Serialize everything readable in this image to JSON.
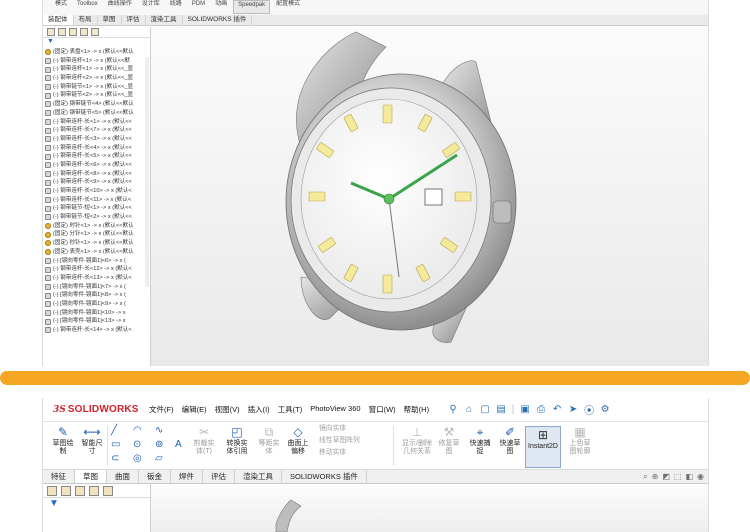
{
  "top": {
    "ribbon": [
      "模式",
      "Toolbox",
      "曲线操作",
      "设计库",
      "线路",
      "PDM",
      "动画",
      "Speedpak",
      "配置模式"
    ],
    "tabs": [
      "装配体",
      "布局",
      "草图",
      "评估",
      "渲染工具",
      "SOLIDWORKS 插件"
    ],
    "tree": [
      "(固定) 表盘<1> -> x (默认<<默认",
      "(-) 钢带连杆<1> -> x (默认<<默",
      "(-) 钢带连杆<1> -> x (默认<<_显",
      "(-) 钢带连杆<2> -> x (默认<<_显",
      "(-) 钢带链节<1> -> x (默认<<_显",
      "(-) 钢带链节<2> -> x (默认<<_显",
      "(固定) 钢带链节<4> (默认<<默认",
      "(固定) 钢带链节<5> (默认<<默认",
      "(-) 钢带连杆-长<1> -> x (默认<<",
      "(-) 钢带连杆-长<7> -> x (默认<<",
      "(-) 钢带连杆-长<3> -> x (默认<<",
      "(-) 钢带连杆-长<4> -> x (默认<<",
      "(-) 钢带连杆-长<5> -> x (默认<<",
      "(-) 钢带连杆-长<6> -> x (默认<<",
      "(-) 钢带连杆-长<8> -> x (默认<<",
      "(-) 钢带连杆-长<9> -> x (默认<<",
      "(-) 钢带连杆-长<10> -> x (默认<",
      "(-) 钢带连杆-长<11> -> x (默认<",
      "(-) 钢带链节-短<1> -> x (默认<<",
      "(-) 钢带链节-短<2> -> x (默认<<",
      "(固定) 时针<1> -> x (默认<<默认",
      "(固定) 分针<1> -> x (默认<<默认",
      "(固定) 秒针<1> -> x (默认<<默认",
      "(固定) 表壳<1> -> x (默认<<默认",
      "(-) [镜向零件-镜面1]<6> -> x (",
      "(-) 钢带连杆-长<12> -> x (默认<",
      "(-) 钢带连杆-长<13> -> x (默认<",
      "(-) [镜向零件-镜面1]<7> -> x (",
      "(-) [镜向零件-镜面1]<8> -> x (",
      "(-) [镜向零件-镜面1]<9> -> x (",
      "(-) [镜向零件-镜面1]<10> -> x",
      "(-) [镜向零件-镜面1]<13> -> x",
      "(-) 钢带连杆-长<14> -> x (默认<"
    ]
  },
  "bottom": {
    "logo_ds": "3S",
    "logo_text": "SOLIDWORKS",
    "menu": [
      "文件(F)",
      "编辑(E)",
      "视图(V)",
      "插入(I)",
      "工具(T)",
      "PhotoView 360",
      "窗口(W)",
      "帮助(H)"
    ],
    "cmd": {
      "sketch": "草图绘\n制",
      "dimension": "智能尺\n寸",
      "trim": "剪裁实\n体(T)",
      "convert": "转换实\n体引用",
      "offset": "等距实\n体",
      "surface_offset": "曲面上\n偏移",
      "mirror": "镜向实体",
      "linear_pattern": "线性草图阵列",
      "move": "移动实体",
      "relations": "显示/删除\n几何关系",
      "repair": "修复草\n图",
      "snap": "快速捕\n捉",
      "rapid": "快速草\n图",
      "instant2d": "Instant2D",
      "shaded": "上色草\n图轮廓"
    },
    "tabs": [
      "特征",
      "草图",
      "曲面",
      "钣金",
      "焊件",
      "评估",
      "渲染工具",
      "SOLIDWORKS 插件"
    ]
  }
}
